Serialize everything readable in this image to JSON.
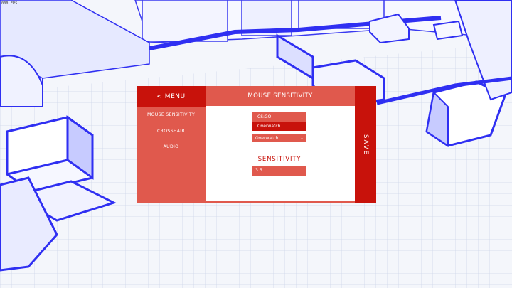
{
  "hud": {
    "fps": "000 FPS"
  },
  "menu": {
    "back_label": "< MENU",
    "title": "MOUSE SENSITIVITY",
    "nav": [
      "MOUSE SENSITIVITY",
      "CROSSHAIR",
      "AUDIO"
    ],
    "save_label": "SAVE",
    "game_dropdown": {
      "options": [
        "CS:GO",
        "Overwatch"
      ],
      "highlighted_option": "Overwatch",
      "selected": "Overwatch"
    },
    "sensitivity_label": "SENSITIVITY",
    "sensitivity_value": "3.5"
  },
  "colors": {
    "primary_red": "#c8120b",
    "light_red": "#e0594d",
    "scene_blue": "#2f2ff2",
    "scene_white": "#ffffff"
  }
}
